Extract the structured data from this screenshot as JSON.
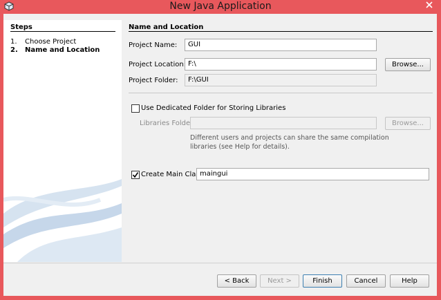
{
  "window": {
    "title": "New Java Application"
  },
  "steps": {
    "title": "Steps",
    "items": [
      {
        "num": "1.",
        "label": "Choose Project"
      },
      {
        "num": "2.",
        "label": "Name and Location"
      }
    ]
  },
  "section": {
    "title": "Name and Location"
  },
  "form": {
    "project_name_label": "Project Name:",
    "project_name_value": "GUI",
    "project_location_label": "Project Location:",
    "project_location_value": "F:\\",
    "browse_label": "Browse...",
    "project_folder_label": "Project Folder:",
    "project_folder_value": "F:\\GUI",
    "dedicated_folder_label": "Use Dedicated Folder for Storing Libraries",
    "dedicated_folder_checked": false,
    "libraries_folder_label": "Libraries Folder:",
    "libraries_folder_value": "",
    "libraries_browse_label": "Browse...",
    "libraries_help_line1": "Different users and projects can share the same compilation",
    "libraries_help_line2": "libraries (see Help for details).",
    "create_main_label": "Create Main Class",
    "create_main_checked": true,
    "main_class_value": "maingui"
  },
  "buttons": {
    "back": "< Back",
    "next": "Next >",
    "finish": "Finish",
    "cancel": "Cancel",
    "help": "Help"
  },
  "colors": {
    "frame": "#e8585c",
    "client": "#f0f0f0"
  }
}
